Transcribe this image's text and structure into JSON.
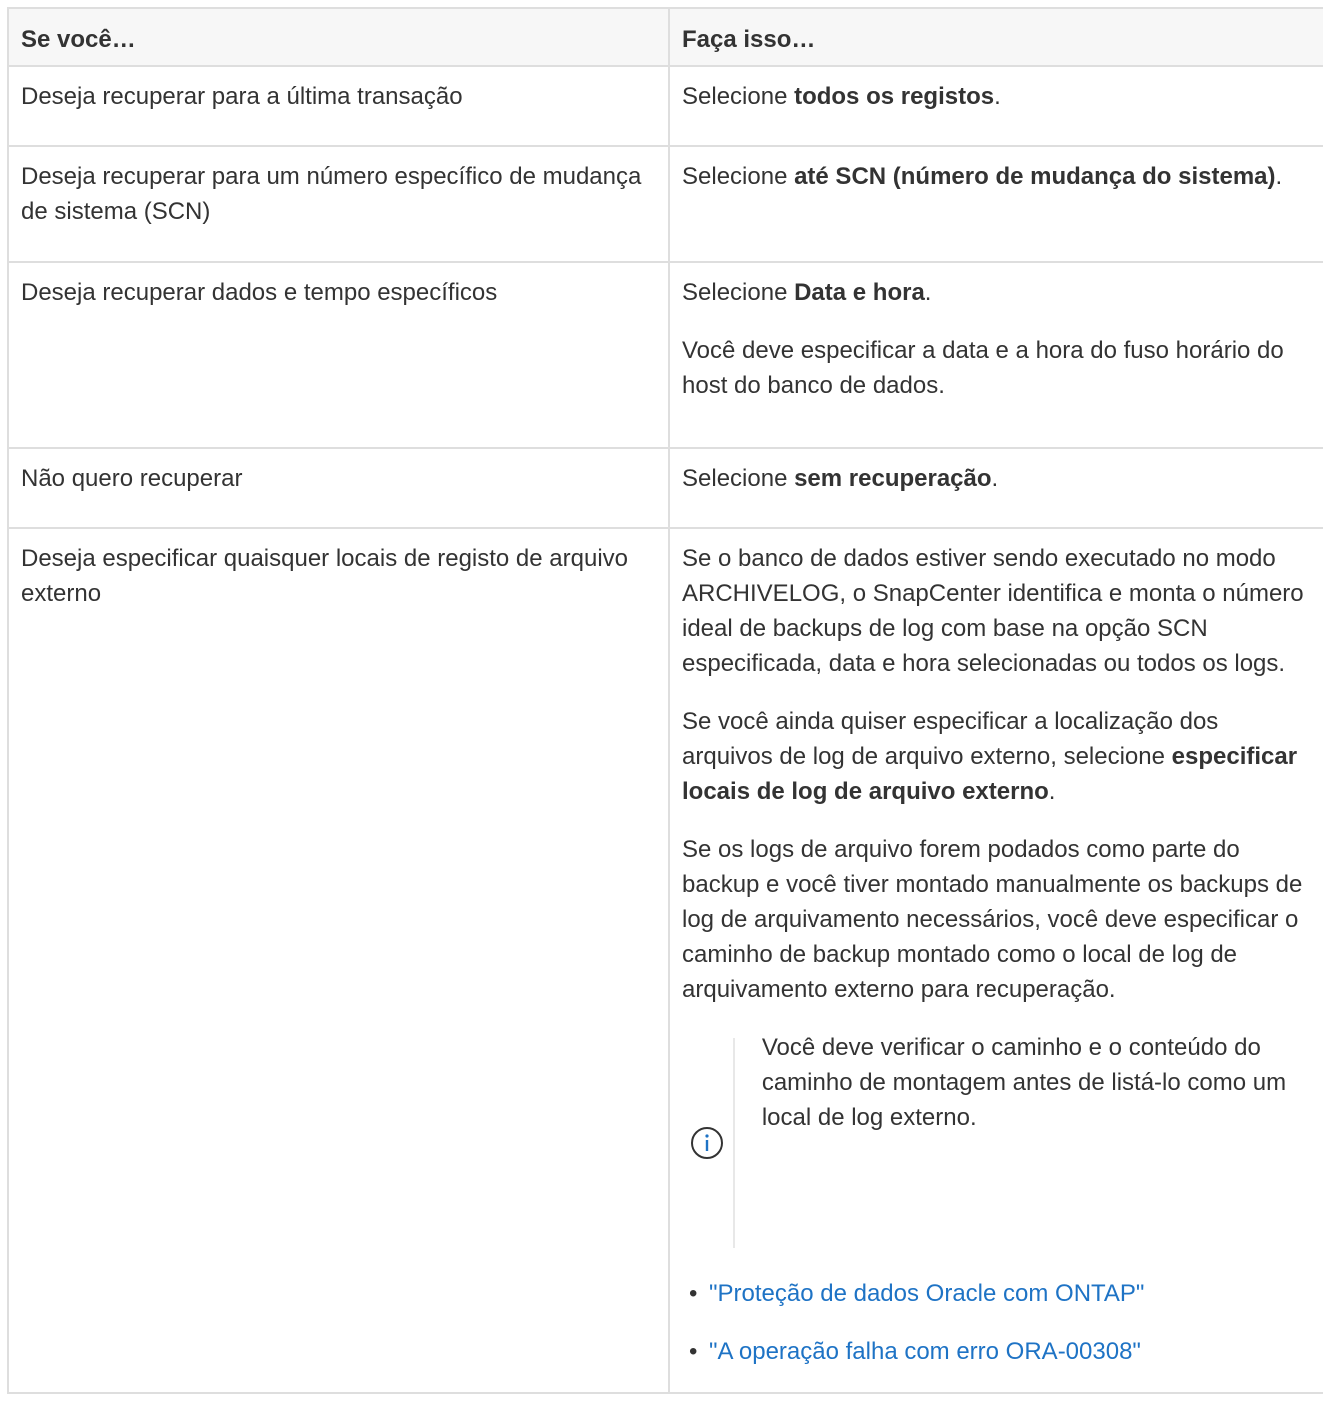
{
  "table": {
    "headers": [
      "Se você…",
      "Faça isso…"
    ],
    "rows": [
      {
        "condition": "Deseja recuperar para a última transação",
        "action_prefix": "Selecione ",
        "action_bold": "todos os registos",
        "action_suffix": "."
      },
      {
        "condition": "Deseja recuperar para um número específico de mudança de sistema (SCN)",
        "action_prefix": "Selecione ",
        "action_bold": "até SCN (número de mudança do sistema)",
        "action_suffix": "."
      },
      {
        "condition": "Deseja recuperar dados e tempo específicos",
        "action_prefix": "Selecione ",
        "action_bold": "Data e hora",
        "action_suffix": ".",
        "note": "Você deve especificar a data e a hora do fuso horário do host do banco de dados."
      },
      {
        "condition": "Não quero recuperar",
        "action_prefix": "Selecione ",
        "action_bold": "sem recuperação",
        "action_suffix": "."
      },
      {
        "condition": "Deseja especificar quaisquer locais de registo de arquivo externo",
        "para1": "Se o banco de dados estiver sendo executado no modo ARCHIVELOG, o SnapCenter identifica e monta o número ideal de backups de log com base na opção SCN especificada, data e hora selecionadas ou todos os logs.",
        "para2_prefix": "Se você ainda quiser especificar a localização dos arquivos de log de arquivo externo, selecione ",
        "para2_bold": "especificar locais de log de arquivo externo",
        "para2_suffix": ".",
        "para3": "Se os logs de arquivo forem podados como parte do backup e você tiver montado manualmente os backups de log de arquivamento necessários, você deve especificar o caminho de backup montado como o local de log de arquivamento externo para recuperação.",
        "callout": "Você deve verificar o caminho e o conteúdo do caminho de montagem antes de listá-lo como um local de log externo.",
        "links": [
          "\"Proteção de dados Oracle com ONTAP\"",
          "\"A operação falha com erro ORA-00308\""
        ]
      }
    ]
  },
  "icons": {
    "callout_icon": "info-icon"
  }
}
